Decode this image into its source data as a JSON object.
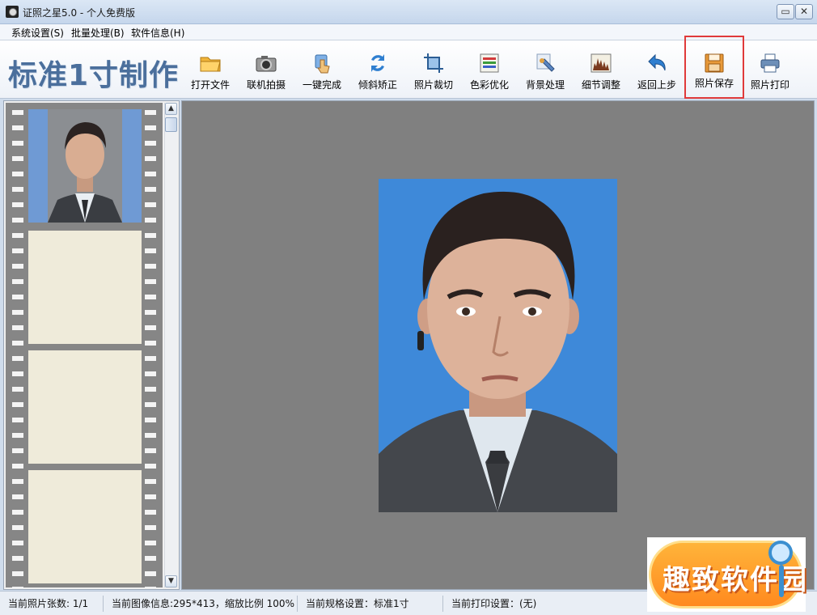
{
  "window": {
    "title": "证照之星5.0 - 个人免费版",
    "minimize": "▭",
    "close": "✕"
  },
  "menu": {
    "items": [
      {
        "label": "系统设置(S)"
      },
      {
        "label": "批量处理(B)"
      },
      {
        "label": "软件信息(H)"
      }
    ]
  },
  "toolbar": {
    "heading": "标准1寸制作",
    "buttons": [
      {
        "label": "打开文件",
        "icon": "folder-icon"
      },
      {
        "label": "联机拍摄",
        "icon": "camera-icon"
      },
      {
        "label": "一键完成",
        "icon": "hand-pointer-icon"
      },
      {
        "label": "倾斜矫正",
        "icon": "rotate-icon"
      },
      {
        "label": "照片裁切",
        "icon": "crop-icon"
      },
      {
        "label": "色彩优化",
        "icon": "color-bars-icon"
      },
      {
        "label": "背景处理",
        "icon": "brush-icon"
      },
      {
        "label": "细节调整",
        "icon": "histogram-icon"
      },
      {
        "label": "返回上步",
        "icon": "undo-icon"
      },
      {
        "label": "照片保存",
        "icon": "floppy-save-icon"
      },
      {
        "label": "照片打印",
        "icon": "printer-icon"
      }
    ],
    "highlighted": "照片保存"
  },
  "filmstrip": {
    "frames": 4,
    "scroll_up": "▲",
    "scroll_down": "▼"
  },
  "statusbar": {
    "photo_count": "当前照片张数: 1/1",
    "image_info": "当前图像信息:295*413，缩放比例 100%",
    "spec": "当前规格设置：标准1寸",
    "print": "当前打印设置：(无)"
  },
  "watermark": {
    "text": "趣致软件园"
  },
  "colors": {
    "photo_background": "#3e89d9",
    "canvas": "#808080",
    "highlight_border": "#e03a3a",
    "heading": "#4b6f9c"
  }
}
